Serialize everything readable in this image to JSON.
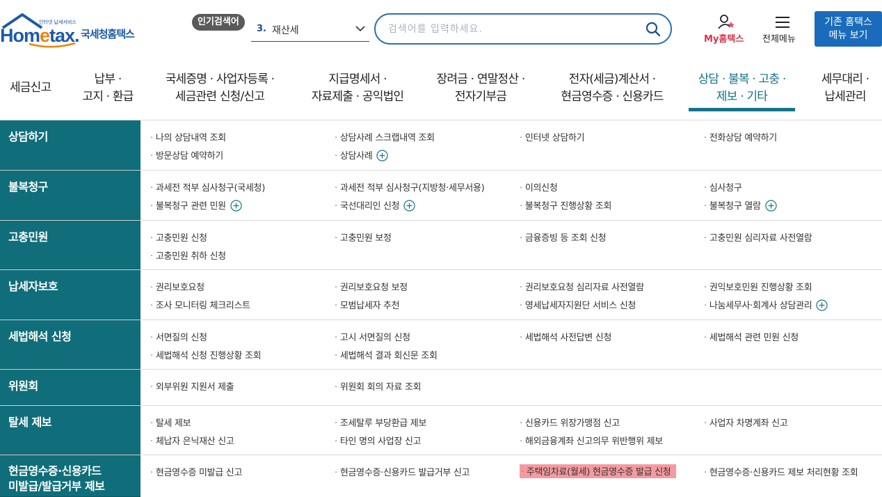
{
  "header": {
    "logo": {
      "tagline": "인터넷 납세서비스",
      "brand_before": "Hom",
      "brand_e": "e",
      "brand_after": "tax.",
      "brand_kr": "국세청홈택스"
    },
    "popular_badge": "인기검색어",
    "popular_rank": "3.",
    "popular_keyword": "재산세",
    "search_placeholder": "검색어를 입력하세요.",
    "my_hometax": "My홈택스",
    "all_menu": "전체메뉴",
    "legacy_line1": "기존 홈택스",
    "legacy_line2": "메뉴 보기"
  },
  "nav": {
    "items": [
      {
        "l1": "세금신고",
        "l2": ""
      },
      {
        "l1": "납부 ·",
        "l2": "고지 · 환급"
      },
      {
        "l1": "국세증명 · 사업자등록 ·",
        "l2": "세금관련 신청/신고"
      },
      {
        "l1": "지급명세서 ·",
        "l2": "자료제출 · 공익법인"
      },
      {
        "l1": "장려금 · 연말정산 ·",
        "l2": "전자기부금"
      },
      {
        "l1": "전자(세금)계산서 ·",
        "l2": "현금영수증 · 신용카드"
      },
      {
        "l1": "상담 · 불복 · 고충 ·",
        "l2": "제보 · 기타"
      },
      {
        "l1": "세무대리 ·",
        "l2": "납세관리"
      }
    ]
  },
  "categories": [
    {
      "title": "상담하기",
      "links": [
        "나의 상담내역 조회",
        "상담사례 스크랩내역 조회",
        "인터넷 상담하기",
        "전화상담 예약하기",
        "방문상담 예약하기",
        "상담사례"
      ]
    },
    {
      "title": "불복청구",
      "links": [
        "과세전 적부 심사청구(국세청)",
        "과세전 적부 심사청구(지방청·세무서용)",
        "이의신청",
        "심사청구",
        "불복청구 관련 민원",
        "국선대리인 신청",
        "불복청구 진행상황 조회",
        "불복청구 열람"
      ]
    },
    {
      "title": "고충민원",
      "links": [
        "고충민원 신청",
        "고충민원 보정",
        "금융증빙 등 조회 신청",
        "고충민원 심리자료 사전열람",
        "고충민원 취하 신청"
      ]
    },
    {
      "title": "납세자보호",
      "links": [
        "권리보호요청",
        "권리보호요청 보정",
        "권리보호요청 심리자료 사전열람",
        "권익보호민원 진행상황 조회",
        "조사 모니터링 체크리스트",
        "모범납세자 추천",
        "영세납세자지원단 서비스 신청",
        "나눔세무사·회계사 상담관리"
      ]
    },
    {
      "title": "세법해석 신청",
      "links": [
        "서면질의 신청",
        "고시 서면질의 신청",
        "세법해석 사전답변 신청",
        "세법해석 관련 민원 신청",
        "세법해석 신청 진행상황 조회",
        "세법해석 결과 회신문 조회"
      ]
    },
    {
      "title": "위원회",
      "links": [
        "외부위원 지원서 제출",
        "위원회 회의 자료 조회"
      ]
    },
    {
      "title": "탈세 제보",
      "links": [
        "탈세 제보",
        "조세탈루 부당환급 제보",
        "신용카드 위장가맹점 신고",
        "사업자 차명계좌 신고",
        "체납자 은닉재산 신고",
        "타인 명의 사업장 신고",
        "해외금융계좌 신고의무 위반행위 제보"
      ]
    },
    {
      "title_l1": "현금영수증·신용카드",
      "title_l2": "미발급/발급거부 제보",
      "links": [
        "현금영수증 미발급 신고",
        "현금영수증·신용카드 발급거부 신고",
        "주택임차료(월세) 현금영수증 발급 신청",
        "현금영수증·신용카드 제보 처리현황 조회"
      ]
    }
  ]
}
